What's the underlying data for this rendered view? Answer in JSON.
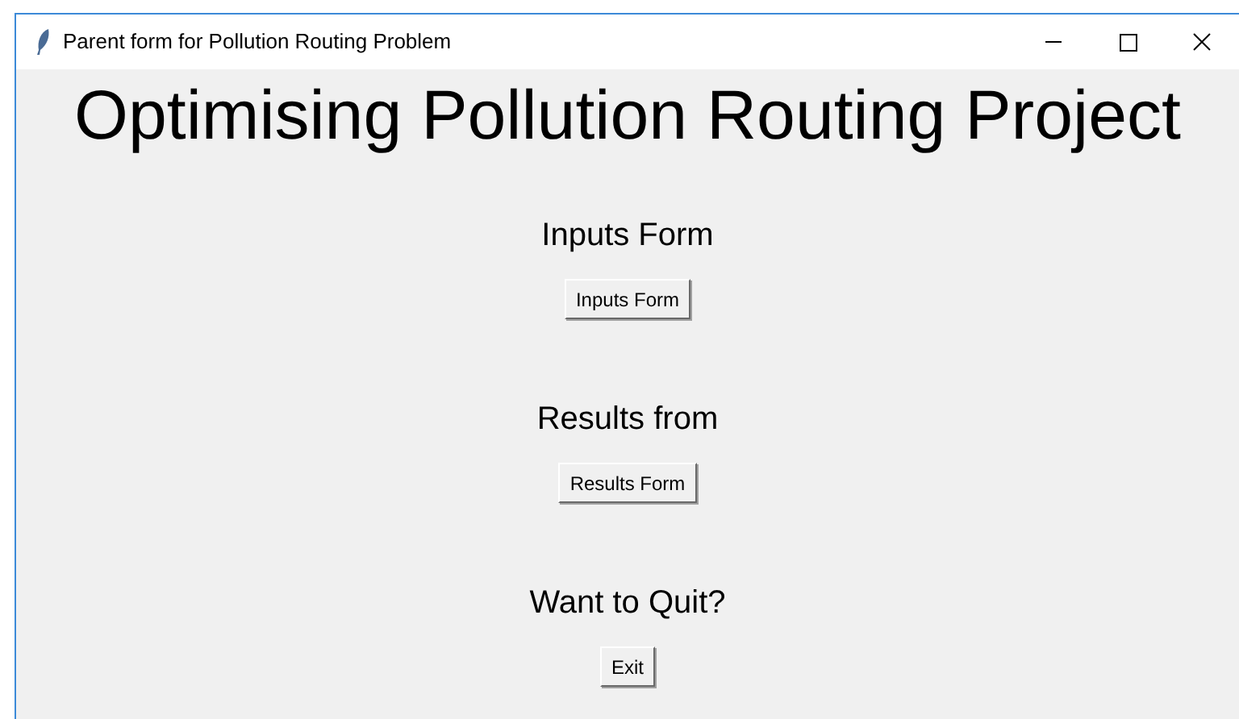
{
  "window": {
    "title": "Parent form for Pollution Routing Problem"
  },
  "heading": "Optimising Pollution Routing Project",
  "sections": [
    {
      "label": "Inputs Form",
      "button": "Inputs Form"
    },
    {
      "label": "Results from",
      "button": "Results Form"
    },
    {
      "label": "Want to Quit?",
      "button": "Exit"
    }
  ]
}
